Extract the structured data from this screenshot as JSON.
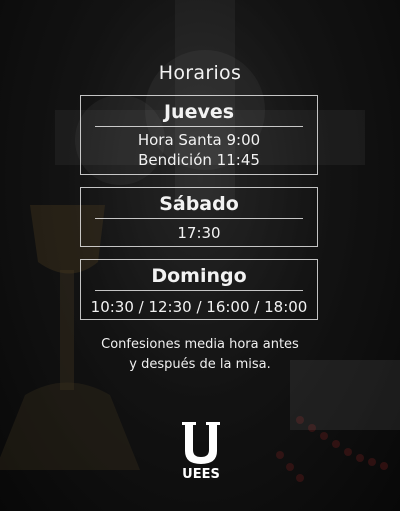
{
  "title": "Horarios",
  "schedule": [
    {
      "day": "Jueves",
      "lines": [
        "Hora Santa 9:00",
        "Bendición 11:45"
      ]
    },
    {
      "day": "Sábado",
      "lines": [
        "17:30"
      ]
    },
    {
      "day": "Domingo",
      "lines": [
        "10:30 / 12:30 / 16:00 / 18:00"
      ]
    }
  ],
  "note": [
    "Confesiones media hora antes",
    "y después de la misa."
  ],
  "logo": {
    "text": "UEES"
  },
  "colors": {
    "text": "#f2f2f2",
    "background": "#1a1a1a"
  }
}
